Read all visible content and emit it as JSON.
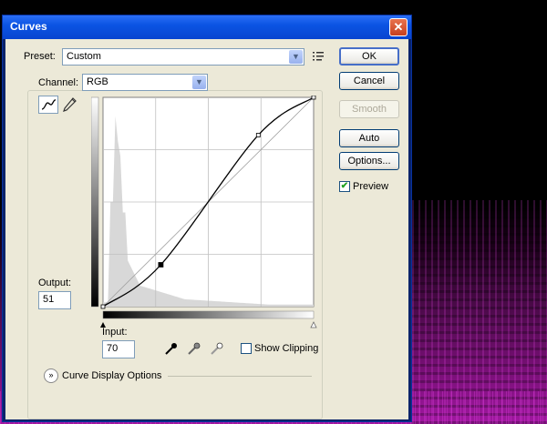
{
  "window": {
    "title": "Curves",
    "close_glyph": "✕"
  },
  "preset": {
    "label": "Preset:",
    "value": "Custom",
    "menu_icon": "preset-options-icon"
  },
  "channel": {
    "label": "Channel:",
    "value": "RGB"
  },
  "tools": {
    "curve_tool_icon": "curve-tool-icon",
    "pencil_tool_icon": "pencil-tool-icon"
  },
  "output": {
    "label": "Output:",
    "value": "51"
  },
  "input": {
    "label": "Input:",
    "value": "70"
  },
  "eyedroppers": [
    "black-point-eyedropper-icon",
    "gray-point-eyedropper-icon",
    "white-point-eyedropper-icon"
  ],
  "show_clipping": {
    "label": "Show Clipping",
    "checked": false
  },
  "curve_display": {
    "label": "Curve Display Options"
  },
  "buttons": {
    "ok": "OK",
    "cancel": "Cancel",
    "smooth": "Smooth",
    "auto": "Auto",
    "options": "Options..."
  },
  "preview": {
    "label": "Preview",
    "checked": true
  },
  "curve_points": [
    [
      0,
      0
    ],
    [
      70,
      51
    ],
    [
      188,
      209
    ],
    [
      255,
      255
    ]
  ],
  "colors": {
    "title_bar": "#0b54e3",
    "dialog_bg": "#ece9d8",
    "histogram": "#d8d8d8",
    "curve": "#000000"
  }
}
